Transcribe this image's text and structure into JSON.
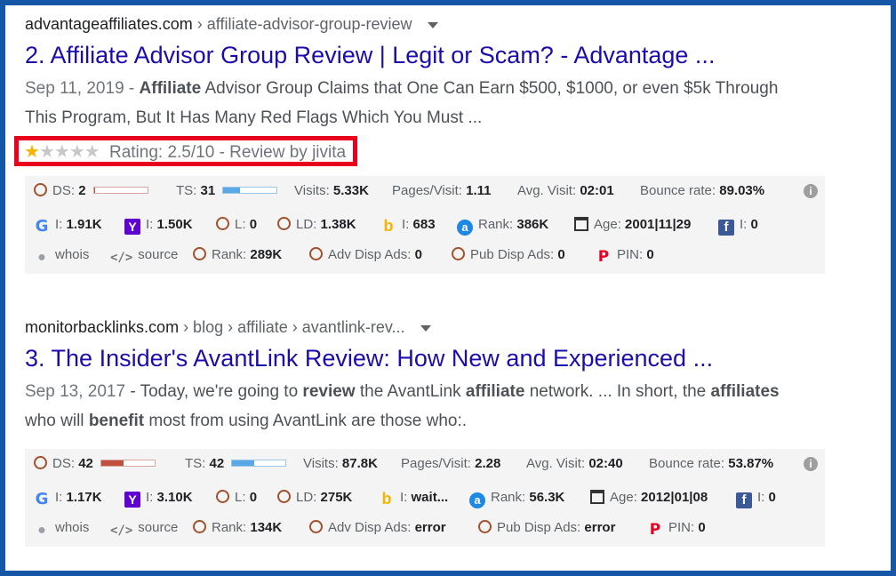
{
  "results": [
    {
      "number": "2.",
      "domain": "advantageaffiliates.com",
      "path": " › affiliate-advisor-group-review",
      "title": "Affiliate Advisor Group Review | Legit or Scam? - Advantage ...",
      "date": "Sep 11, 2019",
      "snippet_parts": [
        "Affiliate",
        " Advisor Group Claims that One Can Earn $500, $1000, or even $5k Through This Program, But It Has Many Red Flags Which You Must ..."
      ],
      "rating": {
        "stars_filled": 1,
        "stars_total": 5,
        "text": "Rating: 2.5/10 - Review by jivita"
      },
      "seo": {
        "ds_label": "DS:",
        "ds_value": "2",
        "ds_fill": 0.02,
        "ts_label": "TS:",
        "ts_value": "31",
        "ts_fill": 0.31,
        "visits_label": "Visits:",
        "visits_value": "5.33K",
        "pages_label": "Pages/Visit:",
        "pages_value": "1.11",
        "avg_label": "Avg. Visit:",
        "avg_value": "02:01",
        "bounce_label": "Bounce rate:",
        "bounce_value": "89.03%",
        "google_label": "I:",
        "google_value": "1.91K",
        "yahoo_label": "I:",
        "yahoo_value": "1.50K",
        "l_label": "L:",
        "l_value": "0",
        "ld_label": "LD:",
        "ld_value": "1.38K",
        "bing_label": "I:",
        "bing_value": "683",
        "alexa_label": "Rank:",
        "alexa_value": "386K",
        "age_label": "Age:",
        "age_value": "2001|11|29",
        "fb_label": "I:",
        "fb_value": "0",
        "whois": "whois",
        "source": "source",
        "rank_label": "Rank:",
        "rank_value": "289K",
        "adv_label": "Adv Disp Ads:",
        "adv_value": "0",
        "pub_label": "Pub Disp Ads:",
        "pub_value": "0",
        "pin_label": "PIN:",
        "pin_value": "0"
      }
    },
    {
      "number": "3.",
      "domain": "monitorbacklinks.com",
      "path": " › blog › affiliate › avantlink-rev...",
      "title": "The Insider's AvantLink Review: How New and Experienced ...",
      "date": "Sep 13, 2017",
      "snippet_parts": [
        " - Today, we're going to ",
        "review",
        " the AvantLink ",
        "affiliate",
        " network. ... In short, the ",
        "affiliates",
        " who will ",
        "benefit",
        " most from using AvantLink are those who:."
      ],
      "seo": {
        "ds_label": "DS:",
        "ds_value": "42",
        "ds_fill": 0.42,
        "ts_label": "TS:",
        "ts_value": "42",
        "ts_fill": 0.42,
        "visits_label": "Visits:",
        "visits_value": "87.8K",
        "pages_label": "Pages/Visit:",
        "pages_value": "2.28",
        "avg_label": "Avg. Visit:",
        "avg_value": "02:40",
        "bounce_label": "Bounce rate:",
        "bounce_value": "53.87%",
        "google_label": "I:",
        "google_value": "1.17K",
        "yahoo_label": "I:",
        "yahoo_value": "3.10K",
        "l_label": "L:",
        "l_value": "0",
        "ld_label": "LD:",
        "ld_value": "275K",
        "bing_label": "I:",
        "bing_value": "wait...",
        "alexa_label": "Rank:",
        "alexa_value": "56.3K",
        "age_label": "Age:",
        "age_value": "2012|01|08",
        "fb_label": "I:",
        "fb_value": "0",
        "whois": "whois",
        "source": "source",
        "rank_label": "Rank:",
        "rank_value": "134K",
        "adv_label": "Adv Disp Ads:",
        "adv_value": "error",
        "pub_label": "Pub Disp Ads:",
        "pub_value": "error",
        "pin_label": "PIN:",
        "pin_value": "0"
      }
    }
  ],
  "icons": {
    "google": "G",
    "yahoo": "Y",
    "bing": "b",
    "alexa": "a",
    "facebook": "f",
    "pinterest": "P",
    "user": "user",
    "code": "</>",
    "info": "i",
    "star": "★"
  },
  "colors": {
    "border": "#1557a6",
    "highlight": "#e8001c",
    "link": "#1a0dab",
    "star": "#f4b400"
  }
}
